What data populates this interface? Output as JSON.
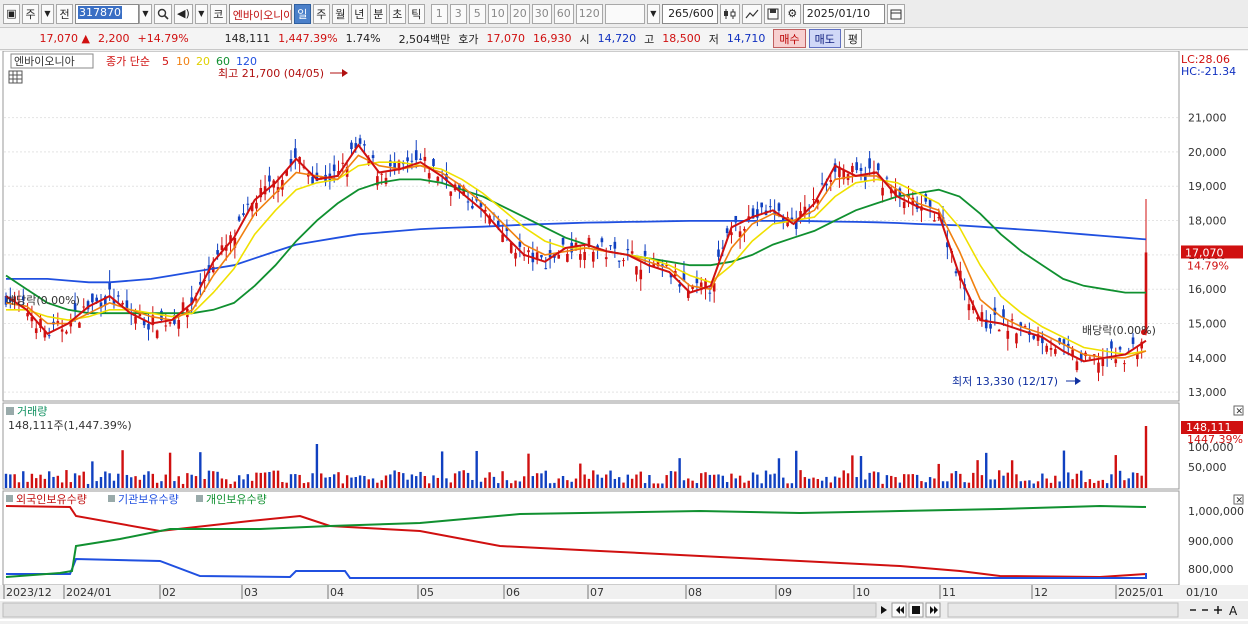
{
  "toolbar": {
    "btn_ju": "주",
    "btn_jeon": "전",
    "code": "317870",
    "btn_ko": "코",
    "stock_name": "엔바이오니아",
    "periods": [
      "일",
      "주",
      "월",
      "년",
      "분",
      "초",
      "틱"
    ],
    "active_period": "일",
    "intervals": [
      "1",
      "3",
      "5",
      "10",
      "20",
      "30",
      "60",
      "120"
    ],
    "count": "265",
    "count_total": "/600",
    "date": "2025/01/10"
  },
  "quote": {
    "price": "17,070",
    "arrow": "▲",
    "change": "2,200",
    "change_pct": "+14.79%",
    "volume": "148,111",
    "volume_ratio": "1,447.39%",
    "turnover": "1.74%",
    "amount": "2,504백만",
    "hoga_label": "호가",
    "ask": "17,070",
    "bid": "16,930",
    "open_label": "시",
    "open": "14,720",
    "high_label": "고",
    "high": "18,500",
    "low_label": "저",
    "low": "14,710",
    "buy_label": "매수",
    "sell_label": "매도",
    "eq_label": "평"
  },
  "price_panel": {
    "legend_name": "엔바이오니아",
    "legend_ma_label": "종가 단순",
    "ma_labels": [
      "5",
      "10",
      "20",
      "60",
      "120"
    ],
    "lc": "LC:28.06",
    "hc": "HC:-21.34",
    "high_annot": "최고 21,700 (04/05)",
    "low_annot": "최저 13,330 (12/17)",
    "div_left": "배당락(0.00%)",
    "div_right": "배당락(0.00%)",
    "current_price_tag": "17,070",
    "current_pct_tag": "14.79%"
  },
  "volume_panel": {
    "title": "거래량",
    "value": "148,111주(1,447.39%)",
    "tag_value": "148,111",
    "tag_pct": "1447.39%",
    "ticks": [
      "100,000",
      "50,000"
    ]
  },
  "holdings_panel": {
    "legend": [
      "외국인보유수량",
      "기관보유수량",
      "개인보유수량"
    ],
    "ticks": [
      "1,000,000",
      "900,000",
      "800,000"
    ]
  },
  "x_axis": {
    "labels": [
      "2023/12",
      "2024/01",
      "02",
      "03",
      "04",
      "05",
      "06",
      "07",
      "08",
      "09",
      "10",
      "11",
      "12",
      "2025/01"
    ],
    "right_label": "01/10"
  },
  "colors": {
    "up": "#d01010",
    "down": "#1040c0",
    "ma5": "#d01010",
    "ma10": "#f08010",
    "ma20": "#f0e000",
    "ma60": "#109030",
    "ma120": "#2050e0"
  },
  "chart_data": {
    "type": "line",
    "y_ticks": [
      21000,
      20000,
      19000,
      18000,
      17000,
      16000,
      15000,
      14000,
      13000
    ],
    "y_tick_labels": [
      "21,000",
      "20,000",
      "19,000",
      "18,000",
      "17,000",
      "16,000",
      "15,000",
      "14,000",
      "13,000"
    ],
    "ylim": [
      12800,
      22300
    ],
    "series": [
      {
        "name": "5",
        "values": [
          15800,
          15400,
          14700,
          15000,
          15500,
          15800,
          15300,
          15000,
          15100,
          15600,
          16800,
          17500,
          18600,
          19100,
          19800,
          19200,
          19300,
          20200,
          19400,
          19500,
          19700,
          19300,
          18800,
          18300,
          17600,
          17000,
          16800,
          17200,
          17300,
          17100,
          17000,
          16700,
          16500,
          15900,
          16100,
          17800,
          18100,
          18300,
          17900,
          18500,
          19600,
          19300,
          19400,
          18700,
          18400,
          18200,
          16400,
          15100,
          15000,
          14800,
          14600,
          14200,
          13900,
          14000,
          14100,
          14500
        ]
      },
      {
        "name": "10",
        "values": [
          15600,
          15500,
          15000,
          15000,
          15300,
          15600,
          15400,
          15200,
          15100,
          15400,
          16400,
          17200,
          18200,
          18800,
          19400,
          19300,
          19200,
          19900,
          19600,
          19500,
          19600,
          19400,
          19000,
          18500,
          17900,
          17300,
          17000,
          17100,
          17200,
          17100,
          17000,
          16800,
          16600,
          16100,
          16000,
          17200,
          17900,
          18200,
          18000,
          18300,
          19200,
          19300,
          19300,
          18900,
          18500,
          18300,
          17100,
          15700,
          15200,
          14900,
          14700,
          14400,
          14100,
          14000,
          14000,
          14200
        ]
      },
      {
        "name": "20",
        "values": [
          15400,
          15400,
          15200,
          15100,
          15200,
          15400,
          15400,
          15300,
          15200,
          15300,
          15900,
          16600,
          17600,
          18300,
          18900,
          19100,
          19200,
          19600,
          19700,
          19700,
          19600,
          19500,
          19200,
          18800,
          18300,
          17800,
          17400,
          17200,
          17200,
          17100,
          17000,
          16900,
          16700,
          16400,
          16200,
          16700,
          17400,
          17900,
          18000,
          18100,
          18700,
          19100,
          19200,
          19100,
          18800,
          18500,
          17800,
          16700,
          15800,
          15300,
          14900,
          14600,
          14300,
          14200,
          14100,
          14200
        ]
      },
      {
        "name": "60",
        "values": [
          16400,
          16000,
          15600,
          15400,
          15300,
          15300,
          15300,
          15300,
          15300,
          15300,
          15400,
          15600,
          16100,
          16700,
          17400,
          18000,
          18500,
          18900,
          19100,
          19200,
          19200,
          19100,
          18900,
          18700,
          18400,
          18100,
          17800,
          17500,
          17300,
          17100,
          17000,
          16900,
          16800,
          16700,
          16700,
          16800,
          17000,
          17300,
          17500,
          17700,
          18000,
          18300,
          18500,
          18700,
          18800,
          18900,
          18700,
          18200,
          17600,
          17100,
          16700,
          16300,
          16100,
          16000,
          15900,
          15900
        ]
      },
      {
        "name": "120",
        "values": [
          16300,
          16300,
          16300,
          16250,
          16200,
          16200,
          16250,
          16300,
          16400,
          16500,
          16600,
          16700,
          16900,
          17100,
          17300,
          17400,
          17500,
          17600,
          17650,
          17700,
          17750,
          17780,
          17800,
          17820,
          17850,
          17880,
          17900,
          17920,
          17940,
          17950,
          17960,
          17970,
          17980,
          17990,
          17990,
          17990,
          17990,
          17990,
          17990,
          17980,
          17970,
          17960,
          17950,
          17930,
          17900,
          17880,
          17860,
          17820,
          17780,
          17740,
          17700,
          17650,
          17600,
          17550,
          17500,
          17450
        ]
      }
    ],
    "current_price": 17070
  }
}
